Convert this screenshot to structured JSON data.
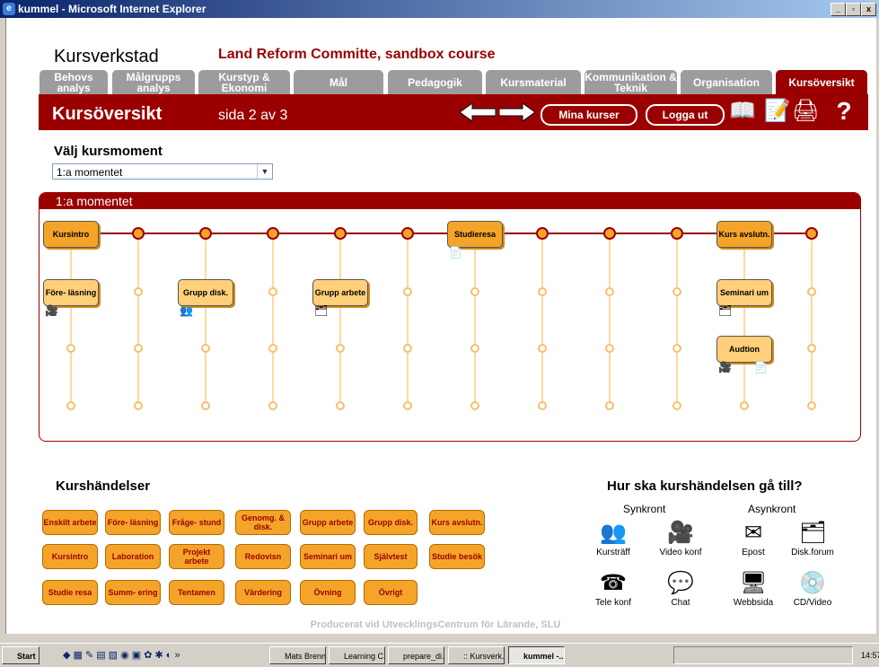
{
  "window": {
    "title": "kummel - Microsoft Internet Explorer",
    "controls": [
      "_",
      "▫",
      "x"
    ]
  },
  "header": {
    "site_title": "Kursverkstad",
    "course_title": "Land Reform Committe, sandbox course",
    "tabs": [
      {
        "label": "Behovs analys",
        "active": false
      },
      {
        "label": "Målgrupps analys",
        "active": false
      },
      {
        "label": "Kurstyp & Ekonomi",
        "active": false
      },
      {
        "label": "Mål",
        "active": false
      },
      {
        "label": "Pedagogik",
        "active": false
      },
      {
        "label": "Kursmaterial",
        "active": false
      },
      {
        "label": "Kommunikation & Teknik",
        "active": false
      },
      {
        "label": "Organisation",
        "active": false
      },
      {
        "label": "Kursöversikt",
        "active": true
      }
    ],
    "page_heading": "Kursöversikt",
    "page_indicator": "sida 2 av 3",
    "buttons": {
      "my_courses": "Mina kurser",
      "logout": "Logga ut"
    },
    "help_icon": "?"
  },
  "selector": {
    "label": "Välj kursmoment",
    "value": "1:a momentet"
  },
  "moment": {
    "title": "1:a momentet",
    "timeline_events": [
      {
        "label": "Kursintro",
        "col": 0,
        "row": 0,
        "media": []
      },
      {
        "label": "Studieresa",
        "col": 6,
        "row": 0,
        "media": [
          "document-icon"
        ]
      },
      {
        "label": "Kurs avslutn.",
        "col": 10,
        "row": 0,
        "media": []
      },
      {
        "label": "Före- läsning",
        "col": 0,
        "row": 1,
        "media": [
          "video-conf-icon"
        ]
      },
      {
        "label": "Grupp disk.",
        "col": 2,
        "row": 1,
        "media": [
          "meeting-icon"
        ]
      },
      {
        "label": "Grupp arbete",
        "col": 4,
        "row": 1,
        "media": [
          "forum-icon"
        ]
      },
      {
        "label": "Seminari um",
        "col": 10,
        "row": 1,
        "media": [
          "forum-icon"
        ]
      },
      {
        "label": "Audtion",
        "col": 10,
        "row": 2,
        "media": [
          "video-conf-icon",
          "document-icon"
        ]
      }
    ]
  },
  "events_section": {
    "title": "Kurshändelser",
    "events": [
      [
        "Enskilt arbete",
        "Före- läsning",
        "Fråge- stund",
        "Genomg. & disk.",
        "Grupp arbete",
        "Grupp disk.",
        "Kurs avslutn."
      ],
      [
        "Kursintro",
        "Laboration",
        "Projekt arbete",
        "Redovisn",
        "Seminari um",
        "Självtest",
        "Studie besök"
      ],
      [
        "Studie resa",
        "Summ- ering",
        "Tentamen",
        "Värdering",
        "Övning",
        "Övrigt"
      ]
    ]
  },
  "how_section": {
    "title": "Hur ska kurshändelsen gå till?",
    "sync_label": "Synkront",
    "async_label": "Asynkront",
    "sync": [
      {
        "label": "Kursträff",
        "icon": "meeting-icon"
      },
      {
        "label": "Video konf",
        "icon": "video-conf-icon"
      },
      {
        "label": "Tele konf",
        "icon": "telephone-icon"
      },
      {
        "label": "Chat",
        "icon": "chat-icon"
      }
    ],
    "async": [
      {
        "label": "Epost",
        "icon": "mail-icon"
      },
      {
        "label": "Disk.forum",
        "icon": "forum-icon"
      },
      {
        "label": "Webbsida",
        "icon": "webpage-icon"
      },
      {
        "label": "CD/Video",
        "icon": "cd-icon"
      }
    ]
  },
  "footer": "Producerat vid UtvecklingsCentrum för Lärande, SLU",
  "taskbar": {
    "start": "Start",
    "items": [
      {
        "label": "Mats Brenn...",
        "active": false
      },
      {
        "label": "Learning C...",
        "active": false
      },
      {
        "label": "prepare_di...",
        "active": false
      },
      {
        "label": ":: Kursverk...",
        "active": false
      },
      {
        "label": "kummel -...",
        "active": true
      }
    ],
    "clock": "14:57"
  },
  "colors": {
    "brand_red": "#9a0000",
    "orange": "#f5a42a",
    "tab_grey": "#9c9c9c"
  }
}
